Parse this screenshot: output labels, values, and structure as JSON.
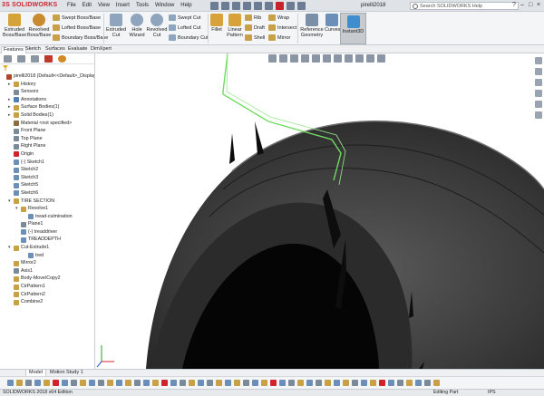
{
  "app": {
    "logo_prefix": "3S",
    "logo": "SOLIDWORKS",
    "doc_title": "pirelli2018",
    "search_placeholder": "Search SOLIDWORKS Help",
    "menus": [
      "File",
      "Edit",
      "View",
      "Insert",
      "Tools",
      "Window",
      "Help"
    ]
  },
  "ribbon": {
    "extruded_boss": "Extruded\nBoss/Base",
    "revolved_boss": "Revolved\nBoss/Base",
    "swept_boss": "Swept Boss/Base",
    "lofted_boss": "Lofted Boss/Base",
    "boundary_boss": "Boundary Boss/Base",
    "extruded_cut": "Extruded\nCut",
    "hole_wizard": "Hole\nWizard",
    "revolved_cut": "Revolved\nCut",
    "swept_cut": "Swept Cut",
    "lofted_cut": "Lofted Cut",
    "boundary_cut": "Boundary Cut",
    "fillet": "Fillet",
    "linear_pattern": "Linear\nPattern",
    "rib": "Rib",
    "draft": "Draft",
    "shell": "Shell",
    "wrap": "Wrap",
    "intersect": "Intersect",
    "mirror": "Mirror",
    "reference_geometry": "Reference\nGeometry",
    "curves": "Curves",
    "instant3d": "Instant3D"
  },
  "tabs": [
    "Features",
    "Sketch",
    "Surfaces",
    "Evaluate",
    "DimXpert"
  ],
  "tree": [
    {
      "label": "pirelli2018  (Default<<Default>_Display St",
      "indent": 0,
      "icon": "#b0452c",
      "exp": ""
    },
    {
      "label": "History",
      "indent": 1,
      "icon": "#c8a046",
      "exp": "▸"
    },
    {
      "label": "Sensors",
      "indent": 1,
      "icon": "#7b8a99",
      "exp": ""
    },
    {
      "label": "Annotations",
      "indent": 1,
      "icon": "#4f7fb8",
      "exp": "▸"
    },
    {
      "label": "Surface Bodies(1)",
      "indent": 1,
      "icon": "#c8a046",
      "exp": "▸"
    },
    {
      "label": "Solid Bodies(1)",
      "indent": 1,
      "icon": "#c8a046",
      "exp": "▸"
    },
    {
      "label": "Material <not specified>",
      "indent": 1,
      "icon": "#8c6d3f",
      "exp": ""
    },
    {
      "label": "Front Plane",
      "indent": 1,
      "icon": "#7b8a99",
      "exp": ""
    },
    {
      "label": "Top Plane",
      "indent": 1,
      "icon": "#7b8a99",
      "exp": ""
    },
    {
      "label": "Right Plane",
      "indent": 1,
      "icon": "#7b8a99",
      "exp": ""
    },
    {
      "label": "Origin",
      "indent": 1,
      "icon": "#d0232d",
      "exp": ""
    },
    {
      "label": "(-) Sketch1",
      "indent": 1,
      "icon": "#6b8fb8",
      "exp": ""
    },
    {
      "label": "Sketch2",
      "indent": 1,
      "icon": "#6b8fb8",
      "exp": ""
    },
    {
      "label": "Sketch3",
      "indent": 1,
      "icon": "#6b8fb8",
      "exp": ""
    },
    {
      "label": "Sketch5",
      "indent": 1,
      "icon": "#6b8fb8",
      "exp": ""
    },
    {
      "label": "Sketch6",
      "indent": 1,
      "icon": "#6b8fb8",
      "exp": ""
    },
    {
      "label": "TIRE SECTION",
      "indent": 1,
      "icon": "#c8a046",
      "exp": "▾"
    },
    {
      "label": "Revolve1",
      "indent": 2,
      "icon": "#c8a046",
      "exp": "▾"
    },
    {
      "label": "tread-culmination",
      "indent": 3,
      "icon": "#6b8fb8",
      "exp": ""
    },
    {
      "label": "Plane1",
      "indent": 2,
      "icon": "#7b8a99",
      "exp": ""
    },
    {
      "label": "(-) treaddriver",
      "indent": 2,
      "icon": "#6b8fb8",
      "exp": ""
    },
    {
      "label": "TREADDEPTH",
      "indent": 2,
      "icon": "#6b8fb8",
      "exp": ""
    },
    {
      "label": "Cut-Extrude1",
      "indent": 1,
      "icon": "#c8a046",
      "exp": "▾"
    },
    {
      "label": "tred",
      "indent": 3,
      "icon": "#6b8fb8",
      "exp": ""
    },
    {
      "label": "Mirror2",
      "indent": 1,
      "icon": "#c8a046",
      "exp": ""
    },
    {
      "label": "Axis1",
      "indent": 1,
      "icon": "#7b8a99",
      "exp": ""
    },
    {
      "label": "Body-Move/Copy2",
      "indent": 1,
      "icon": "#c8a046",
      "exp": ""
    },
    {
      "label": "CirPattern1",
      "indent": 1,
      "icon": "#c8a046",
      "exp": ""
    },
    {
      "label": "CirPattern2",
      "indent": 1,
      "icon": "#c8a046",
      "exp": ""
    },
    {
      "label": "Combine2",
      "indent": 1,
      "icon": "#c8a046",
      "exp": ""
    }
  ],
  "bottom_tabs": [
    "Model",
    "Motion Study 1"
  ],
  "status": {
    "edition": "SOLIDWORKS 2018 x64 Edition",
    "mode": "Editing Part",
    "units": "IPS"
  },
  "colors": {
    "accent": "#d0232d",
    "selection": "#6fdc62",
    "tire": "#3a3a3a"
  }
}
